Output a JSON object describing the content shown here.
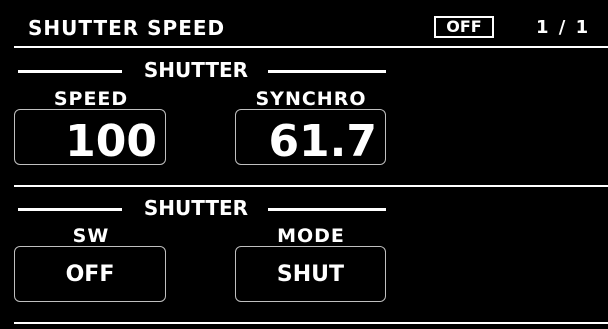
{
  "header": {
    "title": "SHUTTER SPEED",
    "status": "OFF",
    "page": "1 / 1"
  },
  "section1": {
    "group_label": "SHUTTER",
    "speed": {
      "label": "SPEED",
      "value": "100"
    },
    "synchro": {
      "label": "SYNCHRO",
      "value": "61.7"
    }
  },
  "section2": {
    "group_label": "SHUTTER",
    "sw": {
      "label": "SW",
      "value": "OFF"
    },
    "mode": {
      "label": "MODE",
      "value": "SHUT"
    }
  }
}
